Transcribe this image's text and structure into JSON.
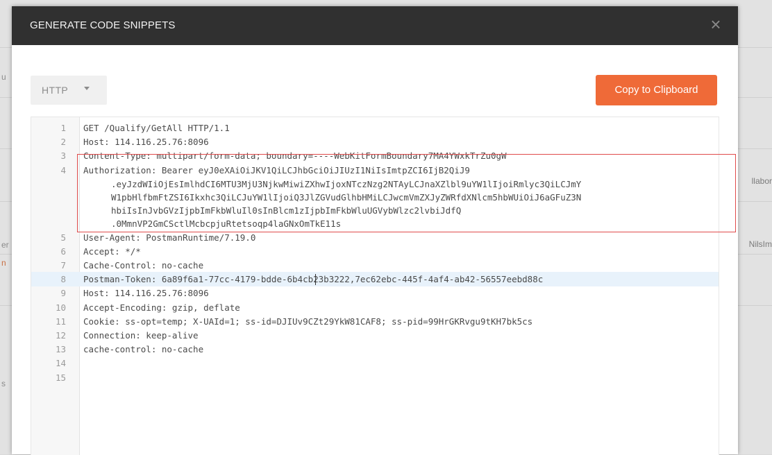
{
  "modal": {
    "title": "GENERATE CODE SNIPPETS",
    "close_icon": "close-icon",
    "language_select": {
      "selected": "HTTP"
    },
    "copy_button": "Copy to Clipboard"
  },
  "background": {
    "right_texts": [
      "llabor",
      "NilsIm"
    ],
    "left_chars": [
      "er",
      "n",
      "s",
      "u"
    ]
  },
  "code": {
    "lines": [
      {
        "num": "1",
        "text": "GET /Qualify/GetAll HTTP/1.1"
      },
      {
        "num": "2",
        "text": "Host: 114.116.25.76:8096"
      },
      {
        "num": "3",
        "text": "Content-Type: multipart/form-data; boundary=----WebKitFormBoundary7MA4YWxkTrZu0gW"
      },
      {
        "num": "4",
        "text": "Authorization: Bearer eyJ0eXAiOiJKV1QiLCJhbGciOiJIUzI1NiIsImtpZCI6IjB2QiJ9",
        "continuation": [
          ".eyJzdWIiOjEsImlhdCI6MTU3MjU3NjkwMiwiZXhwIjoxNTczNzg2NTAyLCJnaXZlbl9uYW1lIjoiRmlyc3QiLCJmY",
          "W1pbHlfbmFtZSI6Ikxhc3QiLCJuYW1lIjoiQ3JlZGVudGlhbHMiLCJwcmVmZXJyZWRfdXNlcm5hbWUiOiJ6aGFuZ3N",
          "hbiIsInJvbGVzIjpbImFkbWluIl0sInBlcm1zIjpbImFkbWluUGVybWlzc2lvbiJdfQ",
          ".0MmnVP2GmCSctlMcbcpjuRtetsoqp4laGNxOmTkE11s"
        ]
      },
      {
        "num": "5",
        "text": "User-Agent: PostmanRuntime/7.19.0"
      },
      {
        "num": "6",
        "text": "Accept: */*"
      },
      {
        "num": "7",
        "text": "Cache-Control: no-cache"
      },
      {
        "num": "8",
        "text": "Postman-Token: 6a89f6a1-77cc-4179-bdde-6b4cb23b3222,7ec62ebc-445f-4af4-ab42-56557eebd88c",
        "active": true
      },
      {
        "num": "9",
        "text": "Host: 114.116.25.76:8096"
      },
      {
        "num": "10",
        "text": "Accept-Encoding: gzip, deflate"
      },
      {
        "num": "11",
        "text": "Cookie: ss-opt=temp; X-UAId=1; ss-id=DJIUv9CZt29YkW81CAF8; ss-pid=99HrGKRvgu9tKH7bk5cs"
      },
      {
        "num": "12",
        "text": "Connection: keep-alive"
      },
      {
        "num": "13",
        "text": "cache-control: no-cache"
      },
      {
        "num": "14",
        "text": ""
      },
      {
        "num": "15",
        "text": ""
      }
    ]
  }
}
